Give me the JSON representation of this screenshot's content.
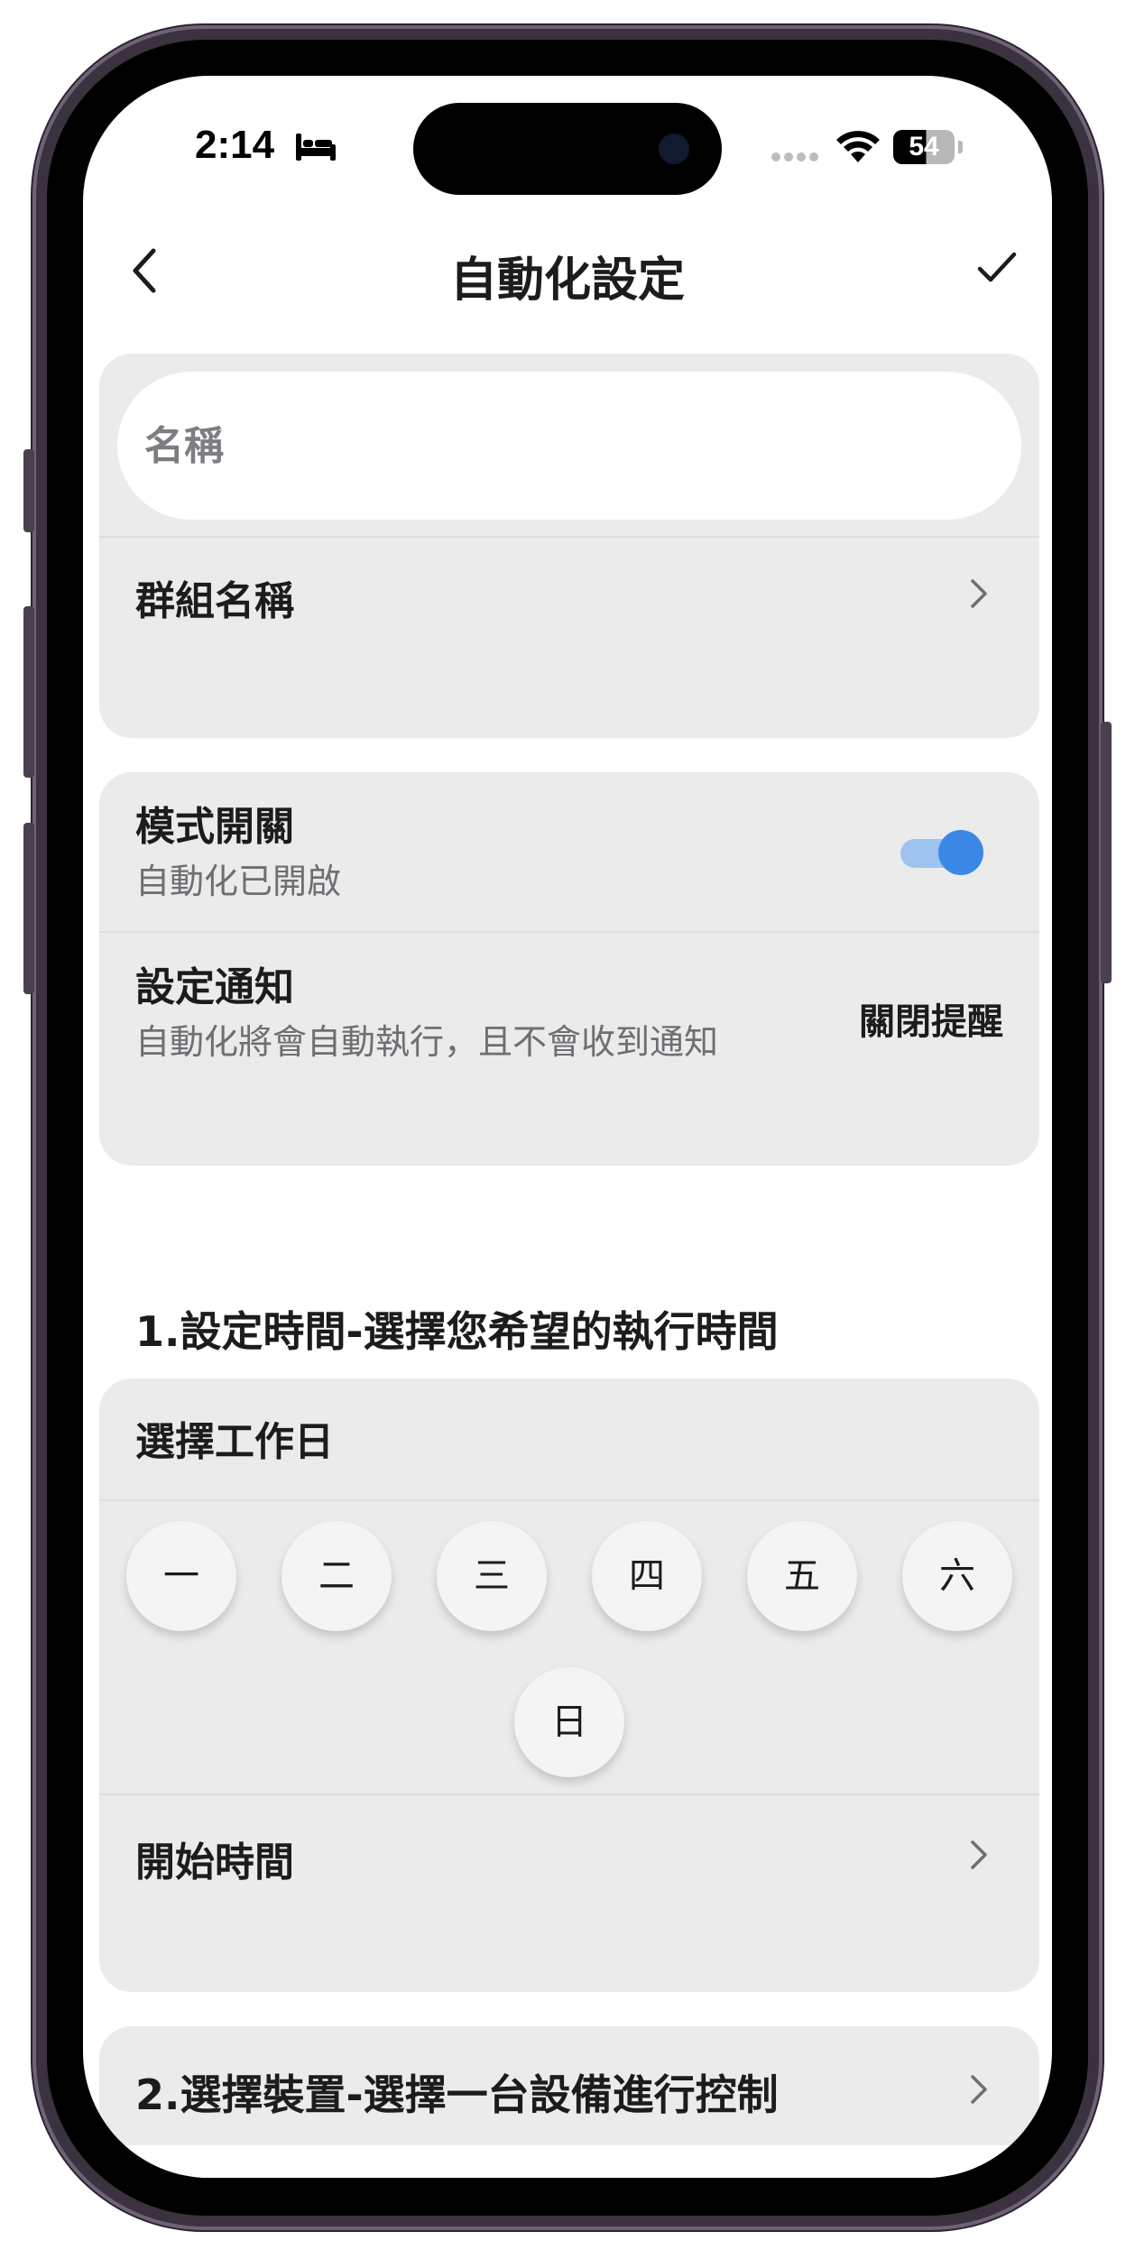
{
  "status_bar": {
    "time": "2:14",
    "battery": "54"
  },
  "nav": {
    "title": "自動化設定"
  },
  "name_section": {
    "name_placeholder": "名稱",
    "group_label": "群組名稱"
  },
  "mode_section": {
    "mode_label": "模式開關",
    "mode_status": "自動化已開啟",
    "mode_enabled": true,
    "notify_label": "設定通知",
    "notify_desc": "自動化將會自動執行，且不會收到通知",
    "notify_value": "關閉提醒"
  },
  "time_section": {
    "title": "1.設定時間-選擇您希望的執行時間",
    "workday_label": "選擇工作日",
    "days": [
      "一",
      "二",
      "三",
      "四",
      "五",
      "六",
      "日"
    ],
    "start_time_label": "開始時間"
  },
  "device_section": {
    "title": "2.選擇裝置-選擇一台設備進行控制"
  },
  "icons": {
    "back": "chevron-left-icon",
    "confirm": "checkmark-icon",
    "row_arrow": "chevron-right-icon"
  },
  "colors": {
    "accent": "#3b87e6",
    "toggle_track": "#9ec3ee",
    "card_bg": "#ebebeb"
  }
}
